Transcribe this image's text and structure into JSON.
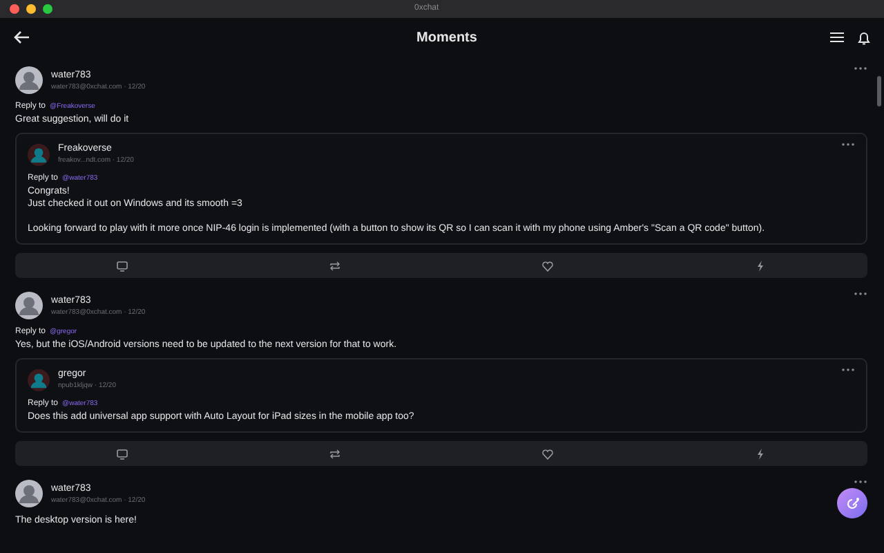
{
  "window": {
    "title": "0xchat"
  },
  "header": {
    "title": "Moments"
  },
  "posts": [
    {
      "author": "water783",
      "meta": "water783@0xchat.com · 12/20",
      "reply_prefix": "Reply to",
      "reply_to": "@Freakoverse",
      "paragraphs": [
        [
          "Great suggestion, will do it"
        ]
      ],
      "actions": true,
      "quote": {
        "author": "Freakoverse",
        "meta": "freakov...ndt.com · 12/20",
        "reply_prefix": "Reply to",
        "reply_to": "@water783",
        "paragraphs": [
          [
            "Congrats!",
            "Just checked it out on Windows and its smooth =3"
          ],
          [
            "Looking forward to play with it more once NIP-46 login is implemented (with a button to show its QR so I can scan it with my phone using Amber's \"Scan a QR code\" button)."
          ]
        ]
      }
    },
    {
      "author": "water783",
      "meta": "water783@0xchat.com · 12/20",
      "reply_prefix": "Reply to",
      "reply_to": "@gregor",
      "paragraphs": [
        [
          "Yes, but the iOS/Android versions need to be updated to the next version for that to work."
        ]
      ],
      "actions": true,
      "quote": {
        "author": "gregor",
        "meta": "npub1kljqw · 12/20",
        "reply_prefix": "Reply to",
        "reply_to": "@water783",
        "paragraphs": [
          [
            "Does this add universal app support with Auto Layout for iPad sizes in the mobile app too?"
          ]
        ]
      }
    },
    {
      "author": "water783",
      "meta": "water783@0xchat.com · 12/20",
      "paragraphs": [
        [
          "The desktop version is here!"
        ]
      ],
      "actions": false
    }
  ]
}
